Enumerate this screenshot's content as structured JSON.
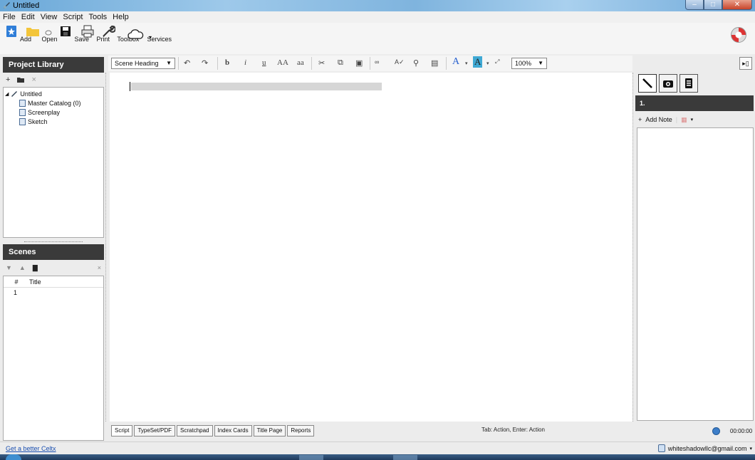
{
  "window": {
    "title": "Untitled"
  },
  "menu": [
    "File",
    "Edit",
    "View",
    "Script",
    "Tools",
    "Help"
  ],
  "toolbar": {
    "add": "Add",
    "open": "Open",
    "save": "Save",
    "print": "Print",
    "toolbox": "Toolbox",
    "services": "Services"
  },
  "project_library": {
    "title": "Project Library",
    "root": "Untitled",
    "items": [
      "Master Catalog (0)",
      "Screenplay",
      "Sketch"
    ]
  },
  "scenes": {
    "title": "Scenes",
    "col_num": "#",
    "col_title": "Title",
    "rows": [
      {
        "num": "1",
        "title": ""
      }
    ]
  },
  "format_bar": {
    "element_type": "Scene Heading",
    "bold": "b",
    "italic": "i",
    "underline": "u",
    "upper": "AA",
    "lower": "aa",
    "zoom": "100%"
  },
  "bottom_tabs": [
    "Script",
    "TypeSet/PDF",
    "Scratchpad",
    "Index Cards",
    "Title Page",
    "Reports"
  ],
  "tab_hint": "Tab: Action, Enter: Action",
  "right_panel": {
    "scene_number": "1.",
    "add_note": "Add Note"
  },
  "timer": "00:00:00",
  "status": {
    "promo_link": "Get a better Celtx",
    "user": "whiteshadowllc@gmail.com"
  },
  "colors": {
    "panel_header": "#3a3a3a",
    "link": "#1a4fb0",
    "font_color_A": "#2a62d0",
    "highlight_A": "#3fa9d4"
  }
}
